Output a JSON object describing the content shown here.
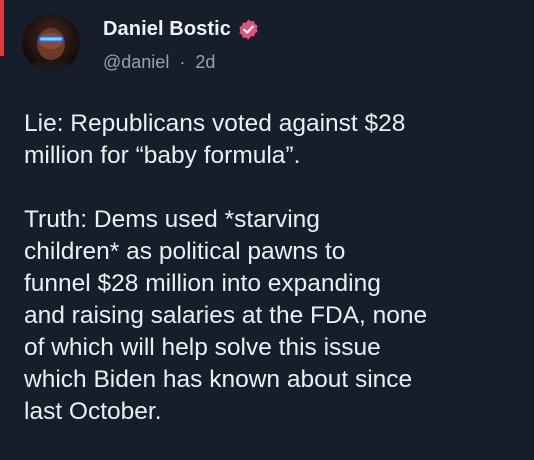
{
  "post": {
    "author": {
      "display_name": "Daniel Bostic",
      "handle": "@daniel",
      "separator": "·",
      "time_ago": "2d",
      "verified_icon": "verified-check-badge",
      "badge_color": "#e2527a"
    },
    "paragraphs": [
      "Lie: Republicans voted against $28\nmillion for “baby formula”.",
      "Truth: Dems used *starving\nchildren* as political pawns to\nfunnel $28 million into expanding\nand raising salaries at the FDA, none\nof which will help solve this issue\nwhich Biden has known about since\nlast October."
    ]
  },
  "theme": {
    "background": "#161e2b",
    "accent": "#e0383e"
  }
}
